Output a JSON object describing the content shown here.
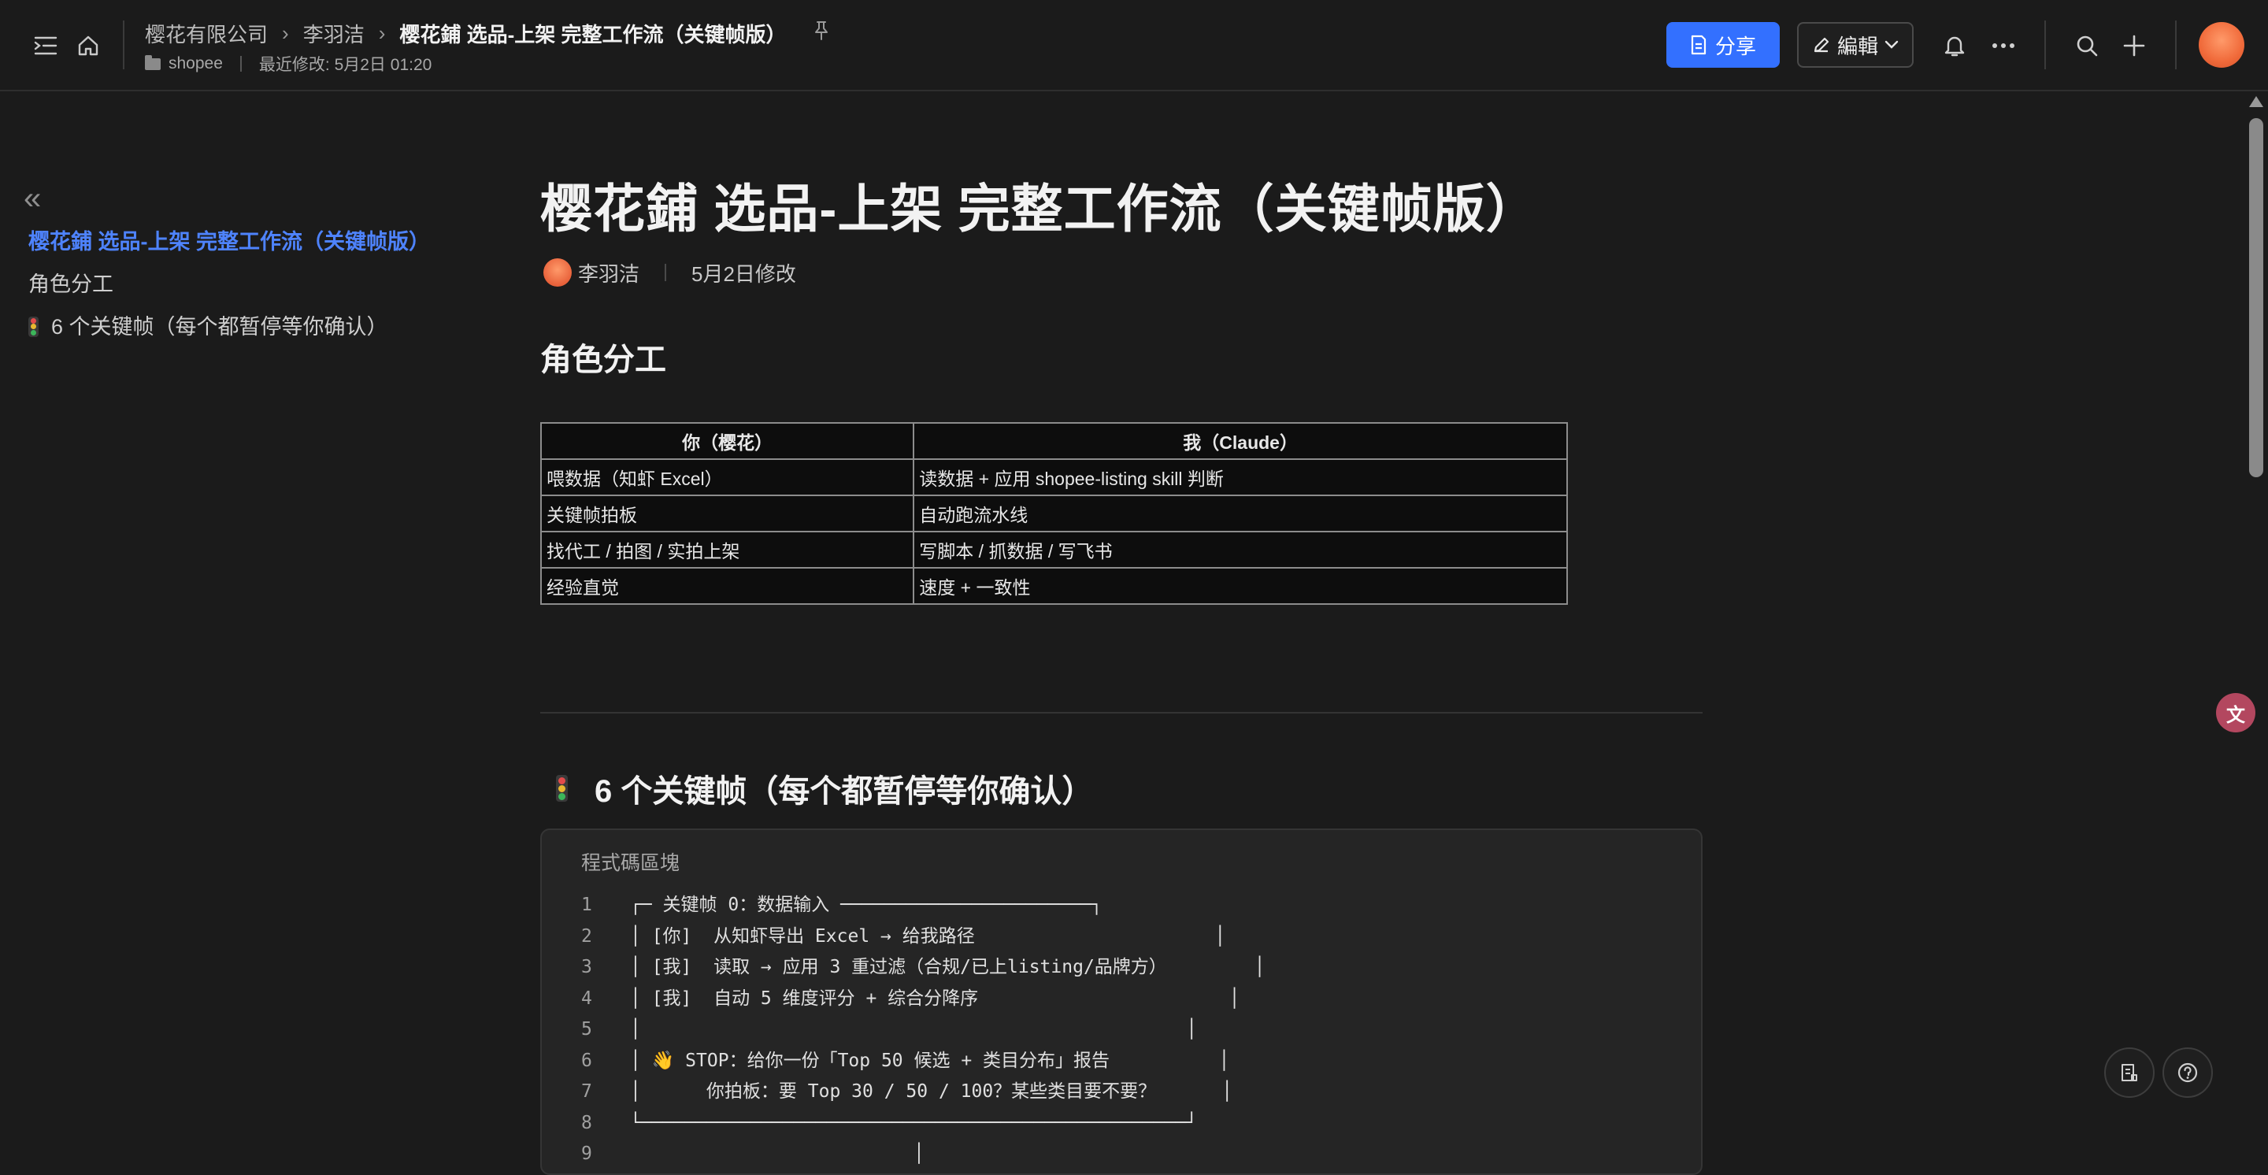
{
  "breadcrumb": {
    "items": [
      "樱花有限公司",
      "李羽洁",
      "樱花鋪 选品-上架 完整工作流（关键帧版）"
    ]
  },
  "meta": {
    "folder": "shopee",
    "last_modified": "最近修改: 5月2日 01:20"
  },
  "toolbar": {
    "share_label": "分享",
    "edit_label": "編輯"
  },
  "outline": {
    "items": [
      "樱花鋪 选品-上架 完整工作流（关键帧版）",
      "角色分工",
      "6 个关键帧（每个都暂停等你确认）"
    ]
  },
  "doc": {
    "title": "樱花鋪 选品-上架 完整工作流（关键帧版）",
    "author": "李羽洁",
    "modified": "5月2日修改",
    "section1": "角色分工",
    "section2": "6 个关键帧（每个都暂停等你确认）"
  },
  "table": {
    "headers": [
      "你（樱花）",
      "我（Claude）"
    ],
    "rows": [
      [
        "喂数据（知虾 Excel）",
        "读数据 + 应用 shopee-listing skill 判断"
      ],
      [
        "关键帧拍板",
        "自动跑流水线"
      ],
      [
        "找代工 / 拍图 / 实拍上架",
        "写脚本 / 抓数据 / 写飞书"
      ],
      [
        "经验直觉",
        "速度 + 一致性"
      ]
    ]
  },
  "code": {
    "label": "程式碼區塊",
    "lines": [
      {
        "n": "1",
        "text": "┌─ 关键帧 0：数据输入 ───────────────────────┐"
      },
      {
        "n": "2",
        "text": "│ [你]  从知虾导出 Excel → 给我路径                      │"
      },
      {
        "n": "3",
        "text": "│ [我]  读取 → 应用 3 重过滤（合规/已上listing/品牌方）        │"
      },
      {
        "n": "4",
        "text": "│ [我]  自动 5 维度评分 + 综合分降序                       │"
      },
      {
        "n": "5",
        "text": "│                                                  │"
      },
      {
        "n": "6",
        "text": "│ 👋 STOP：给你一份「Top 50 候选 + 类目分布」报告          │"
      },
      {
        "n": "7",
        "text": "│      你拍板：要 Top 30 / 50 / 100？某些类目要不要？      │"
      },
      {
        "n": "8",
        "text": "└──────────────────────────────────────────────────┘"
      },
      {
        "n": "9",
        "text": "                          │"
      }
    ]
  }
}
